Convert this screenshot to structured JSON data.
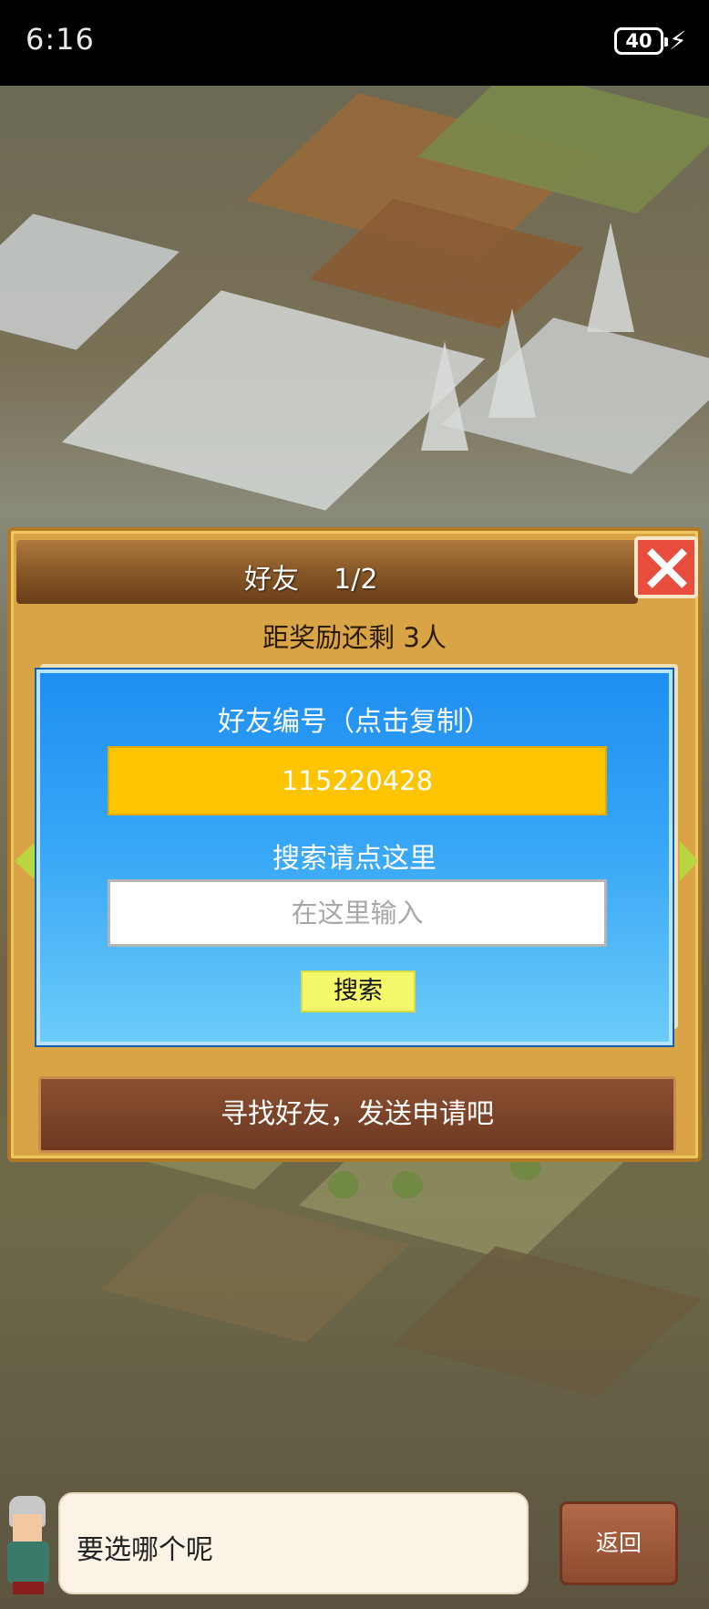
{
  "status_bar": {
    "time": "6:16",
    "battery": "40"
  },
  "panel": {
    "title": "好友    1/2",
    "close_icon": "close-x",
    "reward_text": "距奖励还剩 3人",
    "find_friends_label": "寻找好友，发送申请吧"
  },
  "popup": {
    "code_title": "好友编号（点击复制）",
    "friend_code": "115220428",
    "search_title": "搜索请点这里",
    "search_placeholder": "在这里输入",
    "search_value": "",
    "search_button": "搜索"
  },
  "dialog": {
    "message": "要选哪个呢",
    "back_button": "返回"
  },
  "colors": {
    "popup_top": "#1e8ef2",
    "code_box": "#ffc400",
    "search_button": "#f4f76a",
    "close_button": "#e84d3e",
    "panel": "#d9a445"
  }
}
